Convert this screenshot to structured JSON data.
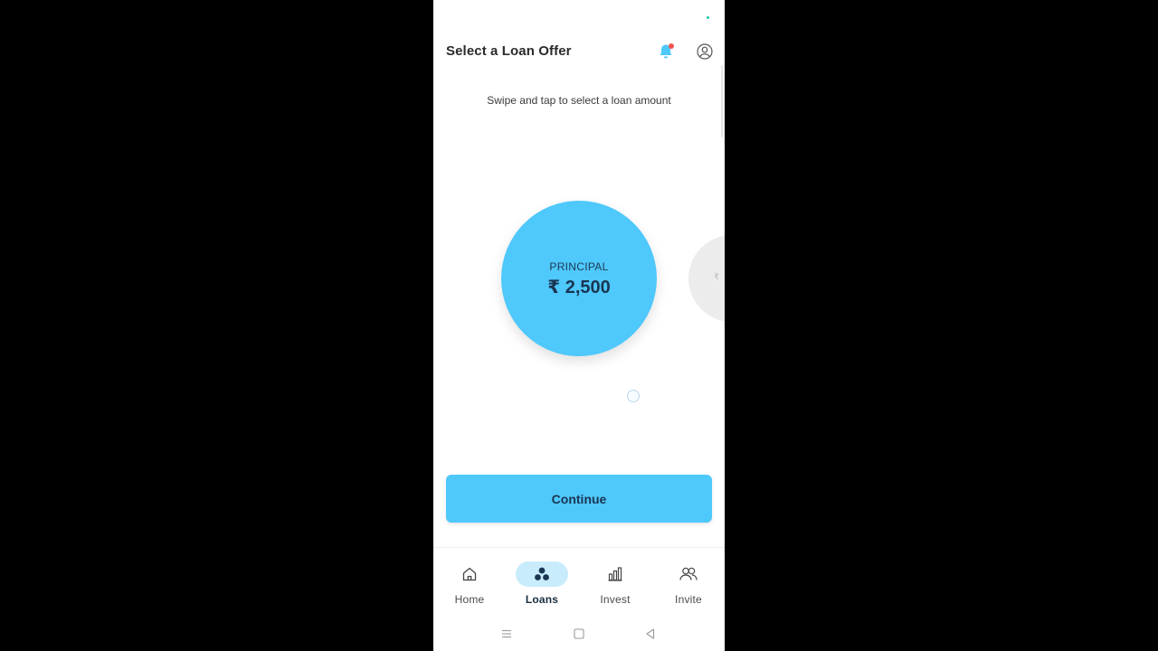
{
  "header": {
    "title": "Select a Loan Offer",
    "notification_icon": "bell-icon",
    "profile_icon": "user-circle-icon"
  },
  "main": {
    "subtitle": "Swipe and tap to select a loan amount",
    "selected_offer": {
      "label": "PRINCIPAL",
      "amount": "₹ 2,500"
    },
    "next_offer": {
      "amount": "₹"
    },
    "continue_label": "Continue"
  },
  "bottom_nav": {
    "items": [
      {
        "label": "Home",
        "icon": "home-icon",
        "active": false
      },
      {
        "label": "Loans",
        "icon": "loans-icon",
        "active": true
      },
      {
        "label": "Invest",
        "icon": "bar-chart-icon",
        "active": false
      },
      {
        "label": "Invite",
        "icon": "people-icon",
        "active": false
      }
    ]
  },
  "colors": {
    "accent": "#4fc8fb",
    "accent_light": "#c8ecfc",
    "text_dark": "#1a3552",
    "badge": "#f0544f",
    "background": "#ffffff",
    "outer_background": "#000000"
  },
  "system_nav": {
    "recents_icon": "recents-icon",
    "home_icon": "square-home-icon",
    "back_icon": "back-triangle-icon"
  }
}
